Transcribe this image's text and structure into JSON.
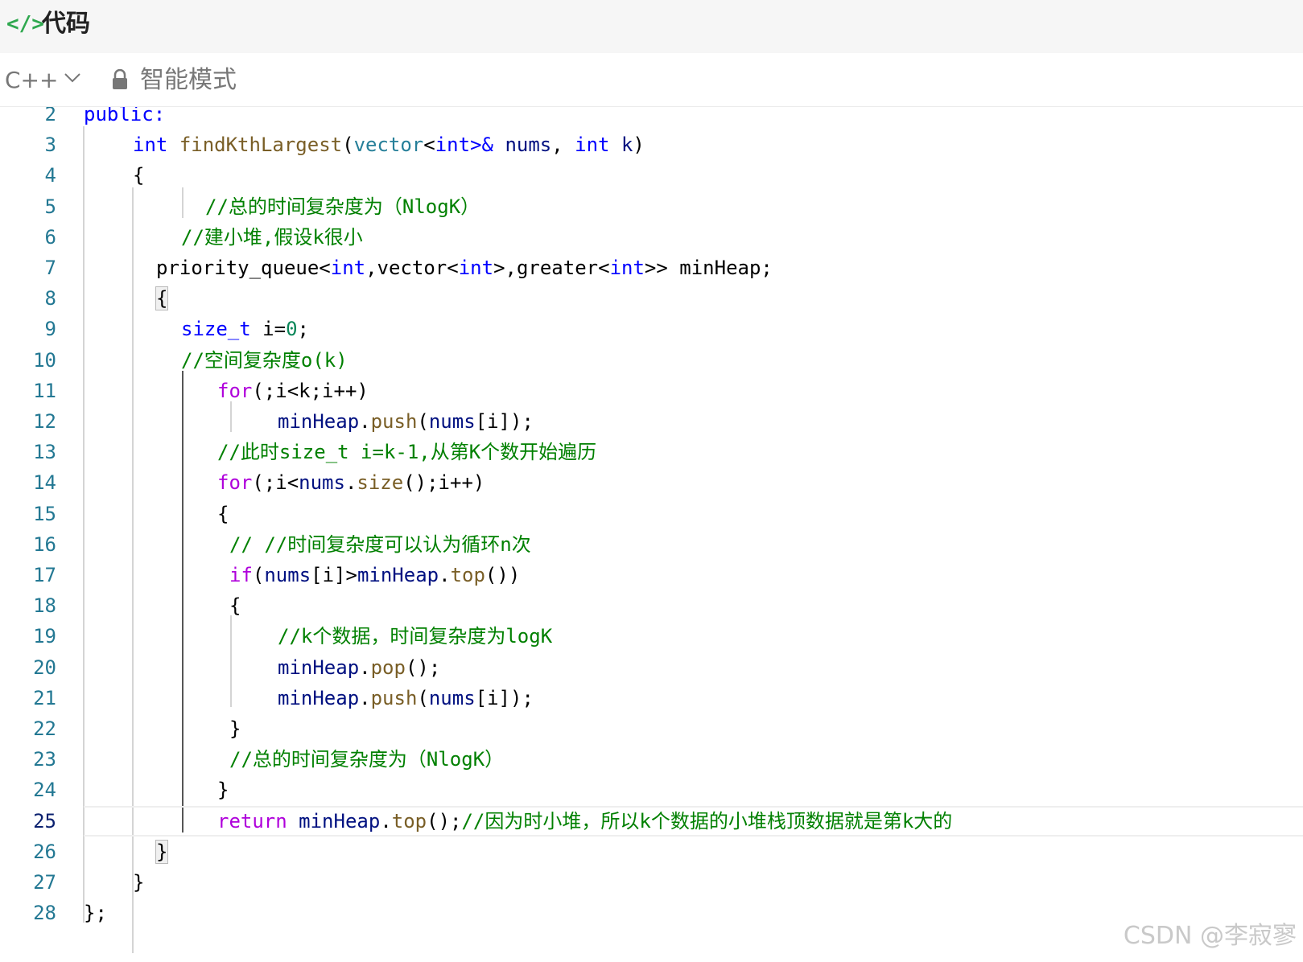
{
  "header": {
    "icon": "</>",
    "icon_name": "code-icon",
    "title": "代码"
  },
  "toolbar": {
    "language": "C++",
    "mode": "智能模式"
  },
  "colors": {
    "keyword": "#0000ff",
    "type": "#267f99",
    "function": "#795e26",
    "control": "#af00db",
    "number": "#098658",
    "variable": "#001080",
    "comment": "#008000",
    "line_number": "#237893"
  },
  "active_line": "25",
  "lines": [
    {
      "n": "2",
      "tokens": [
        [
          "kw",
          "public:"
        ]
      ]
    },
    {
      "n": "3",
      "tokens": [
        [
          "kw",
          "int"
        ],
        [
          "p",
          " "
        ],
        [
          "fn",
          "findKthLargest"
        ],
        [
          "p",
          "("
        ],
        [
          "ty",
          "vector"
        ],
        [
          "p",
          "<"
        ],
        [
          "kw",
          "int"
        ],
        [
          "kw",
          ">&"
        ],
        [
          "p",
          " "
        ],
        [
          "var",
          "nums"
        ],
        [
          "p",
          ", "
        ],
        [
          "kw",
          "int"
        ],
        [
          "p",
          " "
        ],
        [
          "var",
          "k"
        ],
        [
          "p",
          ")"
        ]
      ]
    },
    {
      "n": "4",
      "tokens": [
        [
          "p",
          "{"
        ]
      ]
    },
    {
      "n": "5",
      "tokens": [
        [
          "cm",
          "//总的时间复杂度为（NlogK）"
        ]
      ]
    },
    {
      "n": "6",
      "tokens": [
        [
          "cm",
          "//建小堆,假设k很小"
        ]
      ]
    },
    {
      "n": "7",
      "tokens": [
        [
          "p",
          "priority_queue<"
        ],
        [
          "kw",
          "int"
        ],
        [
          "p",
          ",vector<"
        ],
        [
          "kw",
          "int"
        ],
        [
          "p",
          ">,greater<"
        ],
        [
          "kw",
          "int"
        ],
        [
          "p",
          ">> minHeap;"
        ]
      ]
    },
    {
      "n": "8",
      "tokens": [
        [
          "box",
          "{"
        ]
      ]
    },
    {
      "n": "9",
      "tokens": [
        [
          "kw",
          "size_t"
        ],
        [
          "p",
          " i="
        ],
        [
          "num",
          "0"
        ],
        [
          "p",
          ";"
        ]
      ]
    },
    {
      "n": "10",
      "tokens": [
        [
          "cm",
          "//空间复杂度o(k)"
        ]
      ]
    },
    {
      "n": "11",
      "tokens": [
        [
          "ctl",
          "for"
        ],
        [
          "p",
          "(;i<k;i++)"
        ]
      ]
    },
    {
      "n": "12",
      "tokens": [
        [
          "var",
          "minHeap"
        ],
        [
          "p",
          "."
        ],
        [
          "fn",
          "push"
        ],
        [
          "p",
          "("
        ],
        [
          "var",
          "nums"
        ],
        [
          "p",
          "[i]);"
        ]
      ]
    },
    {
      "n": "13",
      "tokens": [
        [
          "cm",
          "//此时size_t i=k-1,从第K个数开始遍历"
        ]
      ]
    },
    {
      "n": "14",
      "tokens": [
        [
          "ctl",
          "for"
        ],
        [
          "p",
          "(;i<"
        ],
        [
          "var",
          "nums"
        ],
        [
          "p",
          "."
        ],
        [
          "fn",
          "size"
        ],
        [
          "p",
          "();i++)"
        ]
      ]
    },
    {
      "n": "15",
      "tokens": [
        [
          "p",
          "{"
        ]
      ]
    },
    {
      "n": "16",
      "tokens": [
        [
          "cm",
          "// //时间复杂度可以认为循环n次"
        ]
      ]
    },
    {
      "n": "17",
      "tokens": [
        [
          "ctl",
          "if"
        ],
        [
          "p",
          "("
        ],
        [
          "var",
          "nums"
        ],
        [
          "p",
          "[i]>"
        ],
        [
          "var",
          "minHeap"
        ],
        [
          "p",
          "."
        ],
        [
          "fn",
          "top"
        ],
        [
          "p",
          "())"
        ]
      ]
    },
    {
      "n": "18",
      "tokens": [
        [
          "p",
          "{"
        ]
      ]
    },
    {
      "n": "19",
      "tokens": [
        [
          "cm",
          "//k个数据，时间复杂度为logK"
        ]
      ]
    },
    {
      "n": "20",
      "tokens": [
        [
          "var",
          "minHeap"
        ],
        [
          "p",
          "."
        ],
        [
          "fn",
          "pop"
        ],
        [
          "p",
          "();"
        ]
      ]
    },
    {
      "n": "21",
      "tokens": [
        [
          "var",
          "minHeap"
        ],
        [
          "p",
          "."
        ],
        [
          "fn",
          "push"
        ],
        [
          "p",
          "("
        ],
        [
          "var",
          "nums"
        ],
        [
          "p",
          "[i]);"
        ]
      ]
    },
    {
      "n": "22",
      "tokens": [
        [
          "p",
          "}"
        ]
      ]
    },
    {
      "n": "23",
      "tokens": [
        [
          "cm",
          "//总的时间复杂度为（NlogK）"
        ]
      ]
    },
    {
      "n": "24",
      "tokens": [
        [
          "p",
          "}"
        ]
      ]
    },
    {
      "n": "25",
      "tokens": [
        [
          "ctl",
          "return"
        ],
        [
          "p",
          " "
        ],
        [
          "var",
          "minHeap"
        ],
        [
          "p",
          "."
        ],
        [
          "fn",
          "top"
        ],
        [
          "p",
          "();"
        ],
        [
          "cm",
          "//因为时小堆，所以k个数据的小堆栈顶数据就是第k大的"
        ]
      ]
    },
    {
      "n": "26",
      "tokens": [
        [
          "box",
          "}"
        ]
      ]
    },
    {
      "n": "27",
      "tokens": [
        [
          "p",
          "}"
        ]
      ]
    },
    {
      "n": "28",
      "tokens": [
        [
          "p",
          "};"
        ]
      ]
    }
  ],
  "watermark": "CSDN @李寂寥"
}
